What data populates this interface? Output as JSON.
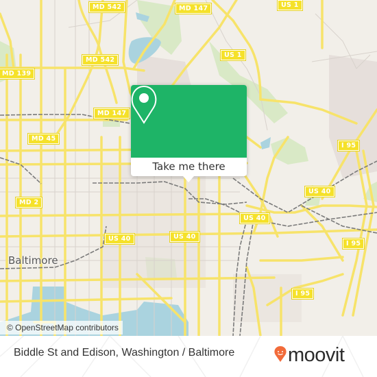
{
  "map": {
    "attribution": "© OpenStreetMap contributors",
    "city_label": "Baltimore",
    "route_shields": [
      {
        "id": "md542-top",
        "label": "MD 542"
      },
      {
        "id": "md147-top",
        "label": "MD 147"
      },
      {
        "id": "us1-top",
        "label": "US 1"
      },
      {
        "id": "md542-mid",
        "label": "MD 542"
      },
      {
        "id": "us1-mid",
        "label": "US 1"
      },
      {
        "id": "md139",
        "label": "MD 139"
      },
      {
        "id": "md147-mid",
        "label": "MD 147"
      },
      {
        "id": "md45",
        "label": "MD 45"
      },
      {
        "id": "i95-upper",
        "label": "I 95"
      },
      {
        "id": "md2",
        "label": "MD 2"
      },
      {
        "id": "us40-right",
        "label": "US 40"
      },
      {
        "id": "us40-center",
        "label": "US 40"
      },
      {
        "id": "us40-mid",
        "label": "US 40"
      },
      {
        "id": "us40-left",
        "label": "US 40"
      },
      {
        "id": "i95-mid",
        "label": "I 95"
      },
      {
        "id": "i95-lower",
        "label": "I 95"
      }
    ],
    "colors": {
      "road": "#f7e36a",
      "land": "#f2efe9",
      "water": "#aad3df",
      "park": "#d6e8c0",
      "rail": "#777777"
    }
  },
  "popup": {
    "button_label": "Take me there",
    "pin_icon": "location-pin-icon",
    "accent_color": "#1eb467"
  },
  "footer": {
    "title": "Biddle St and Edison, Washington / Baltimore",
    "brand": "moovit",
    "brand_color": "#f26b3a"
  }
}
